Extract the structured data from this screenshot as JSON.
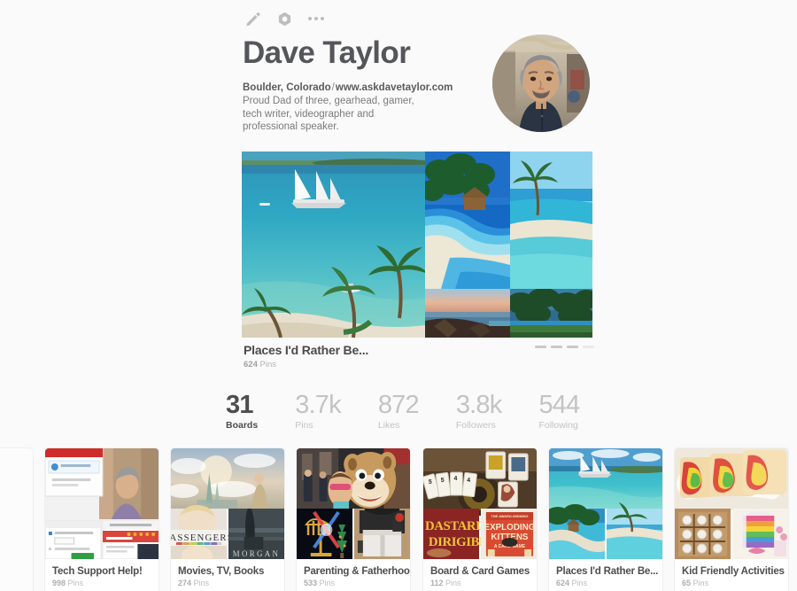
{
  "theme": {
    "bg": "#fafafa",
    "card_bg": "#ffffff",
    "text_dark": "#4e4e4e",
    "text_muted": "#c3c3c3",
    "border": "#efefef"
  },
  "actions": [
    {
      "name": "edit-profile",
      "icon": "pencil-icon",
      "label": "Edit profile"
    },
    {
      "name": "settings",
      "icon": "gear-icon",
      "label": "Settings"
    },
    {
      "name": "more-options",
      "icon": "ellipsis-icon",
      "label": "More"
    }
  ],
  "profile": {
    "name": "Dave Taylor",
    "location": "Boulder, Colorado",
    "separator": "/",
    "website": "www.askdavetaylor.com",
    "bio": "Proud Dad of three, gearhead, gamer, tech writer, videographer and professional speaker.",
    "avatar_alt": "Dave Taylor profile photo"
  },
  "featured_board": {
    "title": "Places I'd Rather Be...",
    "pin_count": "624",
    "pin_label": "Pins",
    "carousel_positions": 4,
    "carousel_active_index": 3
  },
  "stats": [
    {
      "value": "31",
      "label": "Boards",
      "active": true
    },
    {
      "value": "3.7k",
      "label": "Pins",
      "active": false
    },
    {
      "value": "872",
      "label": "Likes",
      "active": false
    },
    {
      "value": "3.8k",
      "label": "Followers",
      "active": false
    },
    {
      "value": "544",
      "label": "Following",
      "active": false
    }
  ],
  "boards": [
    {
      "title": "Tech Support Help!",
      "pin_count": "998",
      "pin_label": "Pins",
      "thumb": "tech"
    },
    {
      "title": "Movies, TV, Books",
      "pin_count": "274",
      "pin_label": "Pins",
      "thumb": "movies"
    },
    {
      "title": "Parenting & Fatherhood",
      "pin_count": "533",
      "pin_label": "Pins",
      "thumb": "parenting"
    },
    {
      "title": "Board & Card Games",
      "pin_count": "112",
      "pin_label": "Pins",
      "thumb": "games"
    },
    {
      "title": "Places I'd Rather Be...",
      "pin_count": "624",
      "pin_label": "Pins",
      "thumb": "places"
    },
    {
      "title": "Kid Friendly Activities",
      "pin_count": "65",
      "pin_label": "Pins",
      "thumb": "kids"
    }
  ]
}
